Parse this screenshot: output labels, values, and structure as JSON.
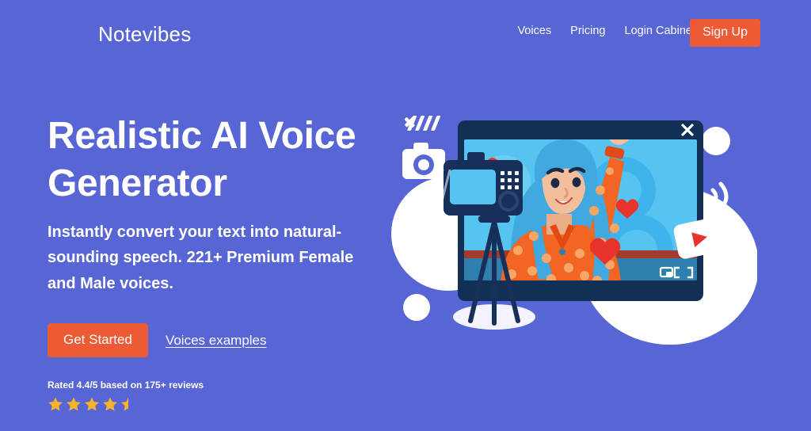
{
  "brand": {
    "logo_text": "Notevibes",
    "accent_orange": "#ED5B35",
    "background_indigo": "#5766D4",
    "star_gold": "#F5B429",
    "text_white": "#FFFFFF"
  },
  "header": {
    "nav": [
      {
        "label": "Voices"
      },
      {
        "label": "Pricing"
      },
      {
        "label": "Login Cabinet"
      }
    ],
    "signup_label": "Sign Up"
  },
  "hero": {
    "headline": "Realistic AI Voice Generator",
    "subheadline": "Instantly convert your text into natural-sounding speech. 221+ Premium Female and Male voices.",
    "primary_cta": "Get Started",
    "secondary_cta": "Voices examples",
    "rating": {
      "full_text": "Rated 4.4/5 based on 175+ reviews",
      "score": "4.4/5",
      "review_count": "175+",
      "stars_full": 4,
      "stars_half": 1,
      "stars_total": 5
    }
  },
  "illustration": {
    "alt": "Woman with blue hair waving inside a video player window, with camera on tripod",
    "icons": [
      "x-mark-icon",
      "speed-lines-icon",
      "camera-icon",
      "close-icon",
      "chat-bubble-icon",
      "heart-icon",
      "play-button-icon",
      "wifi-signal-icon",
      "picture-in-picture-icon",
      "fullscreen-icon"
    ],
    "colors": {
      "window_frame": "#123055",
      "screen_light_blue": "#56C3F0",
      "screen_mid_blue": "#37A9E6",
      "hair_blue": "#3FA9E0",
      "shirt_orange": "#F26522",
      "shirt_dot": "#F9A566",
      "skin": "#F3BE9B",
      "heart_red": "#E8332A",
      "blob_white": "#FFFFFF",
      "camera_navy": "#17305B"
    }
  }
}
